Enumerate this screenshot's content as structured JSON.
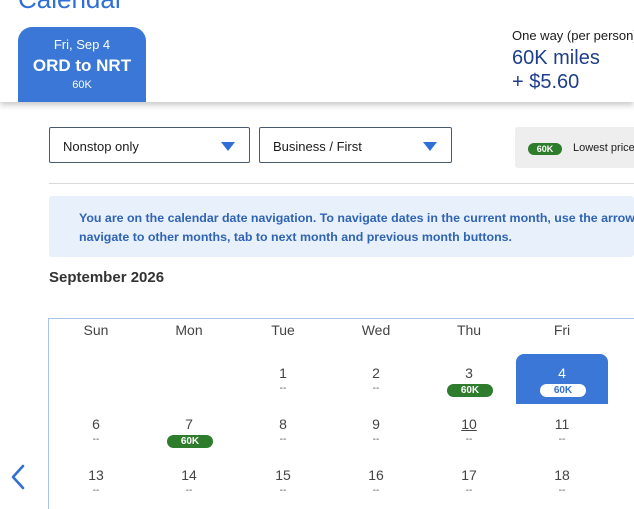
{
  "header": {
    "page_title": "Calendar",
    "trip_tab": {
      "date": "Fri, Sep 4",
      "route": "ORD to NRT",
      "price": "60K"
    },
    "fare": {
      "type": "One way (per person)",
      "miles": "60K miles",
      "cash": "+ $5.60"
    }
  },
  "filters": {
    "stops": "Nonstop only",
    "cabin": "Business / First",
    "legend": {
      "badge": "60K",
      "label": "Lowest price"
    }
  },
  "notice": {
    "line1": "You are on the calendar date navigation. To navigate dates in the current month, use the arrow",
    "line2": "navigate to other months, tab to next month and previous month buttons."
  },
  "calendar": {
    "month": "September 2026",
    "weekdays": [
      "Sun",
      "Mon",
      "Tue",
      "Wed",
      "Thu",
      "Fri"
    ],
    "rows": [
      [
        null,
        null,
        {
          "day": "1",
          "price": "--"
        },
        {
          "day": "2",
          "price": "--"
        },
        {
          "day": "3",
          "price": "60K",
          "lowest": true
        },
        {
          "day": "4",
          "price": "60K",
          "lowest": true,
          "selected": true
        }
      ],
      [
        {
          "day": "6",
          "price": "--"
        },
        {
          "day": "7",
          "price": "60K",
          "lowest": true
        },
        {
          "day": "8",
          "price": "--"
        },
        {
          "day": "9",
          "price": "--"
        },
        {
          "day": "10",
          "price": "--",
          "underlined": true
        },
        {
          "day": "11",
          "price": "--"
        }
      ],
      [
        {
          "day": "13",
          "price": "--"
        },
        {
          "day": "14",
          "price": "--"
        },
        {
          "day": "15",
          "price": "--"
        },
        {
          "day": "16",
          "price": "--"
        },
        {
          "day": "17",
          "price": "--"
        },
        {
          "day": "18",
          "price": "--"
        }
      ]
    ]
  },
  "icons": {
    "prev": "chevron-left-icon",
    "dropdown": "chevron-down-icon"
  },
  "colors": {
    "primary": "#3b77d6",
    "lowest_price": "#2d7d2d",
    "notice_bg": "#e8f0fb"
  }
}
